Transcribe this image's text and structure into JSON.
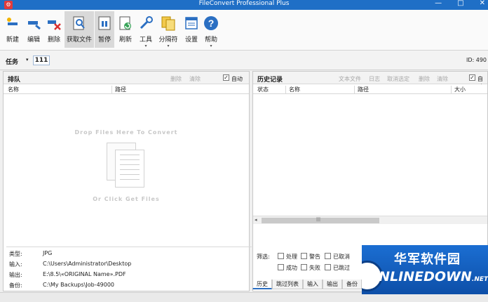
{
  "window": {
    "title": "FileConvert Professional Plus",
    "controls": [
      "—",
      "□",
      "✕"
    ]
  },
  "ribbon": {
    "buttons": [
      {
        "label": "新建",
        "icon": "new-file-icon"
      },
      {
        "label": "编辑",
        "icon": "edit-icon"
      },
      {
        "label": "删除",
        "icon": "delete-icon"
      },
      {
        "label": "获取文件",
        "icon": "get-files-icon"
      },
      {
        "label": "暂停",
        "icon": "pause-icon"
      },
      {
        "label": "刷新",
        "icon": "refresh-icon"
      },
      {
        "label": "工具",
        "icon": "tools-icon"
      },
      {
        "label": "分隔符",
        "icon": "separator-icon"
      },
      {
        "label": "设置",
        "icon": "settings-icon"
      },
      {
        "label": "帮助",
        "icon": "help-icon"
      }
    ]
  },
  "task": {
    "label": "任务",
    "number": "111",
    "id_text": "ID: 490"
  },
  "queue": {
    "title": "排队",
    "delete_label": "删除",
    "clear_label": "清除",
    "auto_label": "自动",
    "auto_checked": true,
    "columns": [
      "名称",
      "路径"
    ],
    "drop_text": "Drop Files Here To Convert",
    "click_text": "Or Click Get Files",
    "info": [
      {
        "key": "类型:",
        "value": "JPG"
      },
      {
        "key": "输入:",
        "value": "C:\\Users\\Administrator\\Desktop"
      },
      {
        "key": "输出:",
        "value": "E:\\8.5\\«ORIGINAL Name».PDF"
      },
      {
        "key": "备份:",
        "value": "C:\\My Backups\\Job-49000"
      }
    ]
  },
  "history": {
    "title": "历史记录",
    "links": [
      "文本文件",
      "日志",
      "取消选定",
      "删除",
      "清除"
    ],
    "auto_label": "自动",
    "auto_checked": true,
    "columns": [
      "状态",
      "名称",
      "路径",
      "大小"
    ],
    "filter_label": "筛选:",
    "filters": [
      "处理",
      "警告",
      "已取消",
      "成功",
      "失败",
      "已跳过"
    ],
    "tabs": [
      "历史",
      "跳过列表",
      "输入",
      "输出",
      "备份"
    ],
    "scroll_grip": "|||"
  },
  "watermark": {
    "cn": "华军软件园",
    "en": "ONLINEDOWN",
    "suffix": ".NET"
  }
}
